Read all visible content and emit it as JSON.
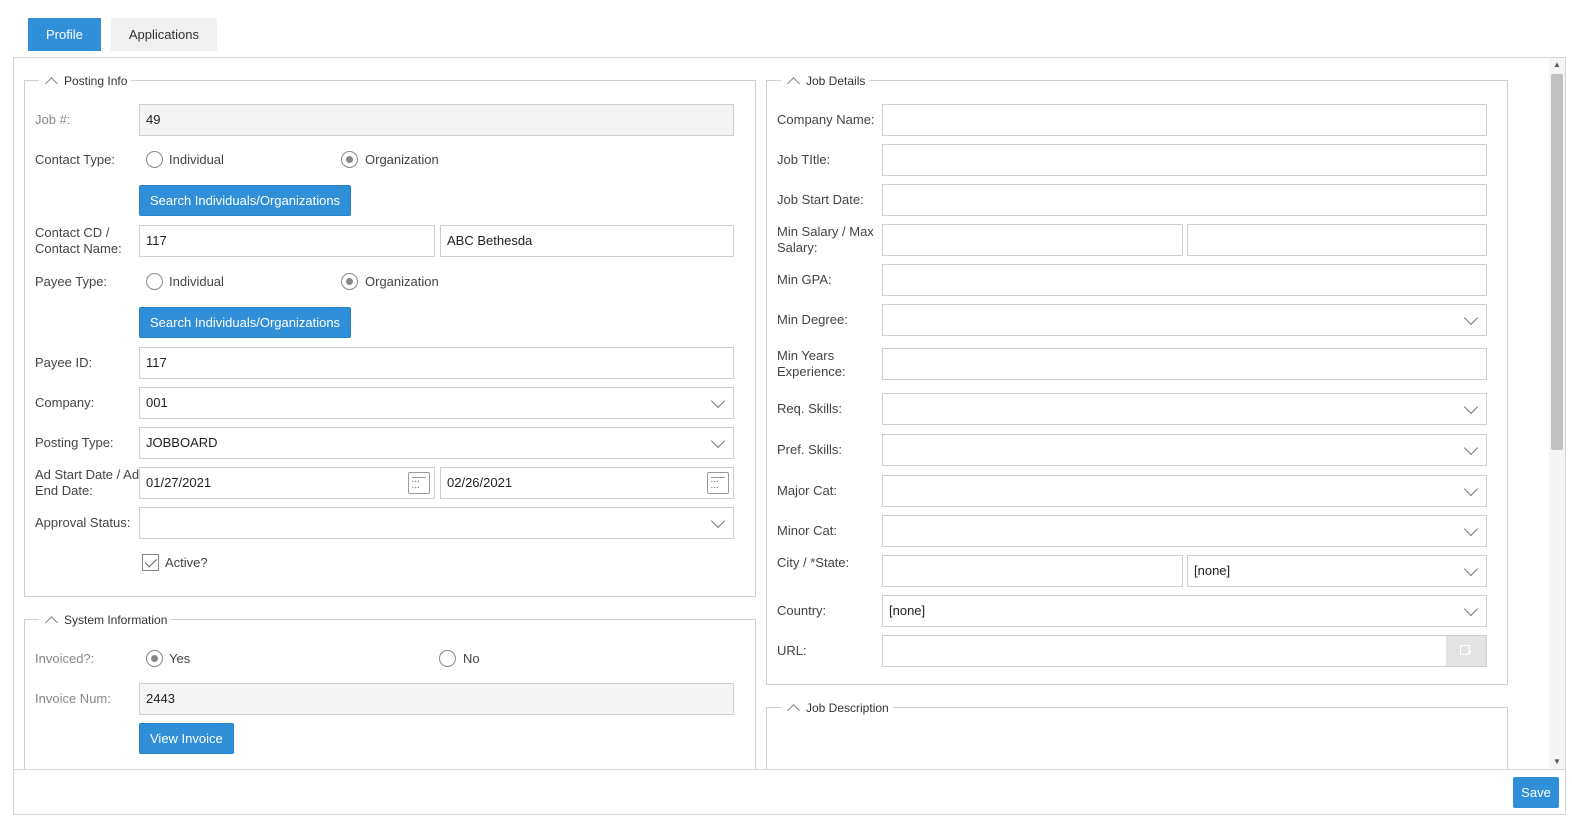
{
  "tabs": [
    {
      "label": "Profile",
      "active": true
    },
    {
      "label": "Applications",
      "active": false
    }
  ],
  "posting_info": {
    "title": "Posting Info",
    "job_num": {
      "label": "Job #:",
      "value": "49"
    },
    "contact_type": {
      "label": "Contact Type:",
      "option_individual": "Individual",
      "option_organization": "Organization",
      "selected": "Organization"
    },
    "search_button_1": "Search Individuals/Organizations",
    "contact": {
      "label_line1": "Contact CD /",
      "label_line2": "Contact Name:",
      "cd": "117",
      "name": "ABC Bethesda"
    },
    "payee_type": {
      "label": "Payee Type:",
      "option_individual": "Individual",
      "option_organization": "Organization",
      "selected": "Organization"
    },
    "search_button_2": "Search Individuals/Organizations",
    "payee_id": {
      "label": "Payee ID:",
      "value": "117"
    },
    "company": {
      "label": "Company:",
      "value": "001"
    },
    "posting_type": {
      "label": "Posting Type:",
      "value": "JOBBOARD"
    },
    "ad_dates": {
      "label_line1": "Ad Start Date / Ad",
      "label_line2": "End Date:",
      "start": "01/27/2021",
      "end": "02/26/2021"
    },
    "approval_status": {
      "label": "Approval Status:",
      "value": ""
    },
    "active": {
      "label": "Active?",
      "checked": true
    }
  },
  "system_info": {
    "title": "System Information",
    "invoiced": {
      "label": "Invoiced?:",
      "option_yes": "Yes",
      "option_no": "No",
      "selected": "Yes"
    },
    "invoice_num": {
      "label": "Invoice Num:",
      "value": "2443"
    },
    "view_invoice_button": "View Invoice"
  },
  "job_details": {
    "title": "Job Details",
    "company_name": {
      "label": "Company Name:",
      "value": ""
    },
    "job_title": {
      "label": "Job TItle:",
      "value": ""
    },
    "job_start_date": {
      "label": "Job Start Date:",
      "value": ""
    },
    "salary": {
      "label_line1": "Min Salary / Max",
      "label_line2": "Salary:",
      "min": "",
      "max": ""
    },
    "min_gpa": {
      "label": "Min GPA:",
      "value": ""
    },
    "min_degree": {
      "label": "Min Degree:",
      "value": ""
    },
    "min_years": {
      "label_line1": "Min Years",
      "label_line2": "Experience:",
      "value": ""
    },
    "req_skills": {
      "label": "Req. Skills:",
      "value": ""
    },
    "pref_skills": {
      "label": "Pref. Skills:",
      "value": ""
    },
    "major_cat": {
      "label": "Major Cat:",
      "value": ""
    },
    "minor_cat": {
      "label": "Minor Cat:",
      "value": ""
    },
    "city_state": {
      "label": "City / *State:",
      "city": "",
      "state": "[none]"
    },
    "country": {
      "label": "Country:",
      "value": "[none]"
    },
    "url": {
      "label": "URL:",
      "value": ""
    }
  },
  "job_description": {
    "title": "Job Description"
  },
  "footer": {
    "save_label": "Save"
  },
  "colors": {
    "accent": "#2f8fd8",
    "border": "#cfcfcf",
    "readonly_bg": "#f4f4f4"
  },
  "icons": [
    "collapse-chevron-icon",
    "dropdown-chevron-icon",
    "calendar-icon",
    "external-link-icon",
    "checkmark-icon"
  ]
}
